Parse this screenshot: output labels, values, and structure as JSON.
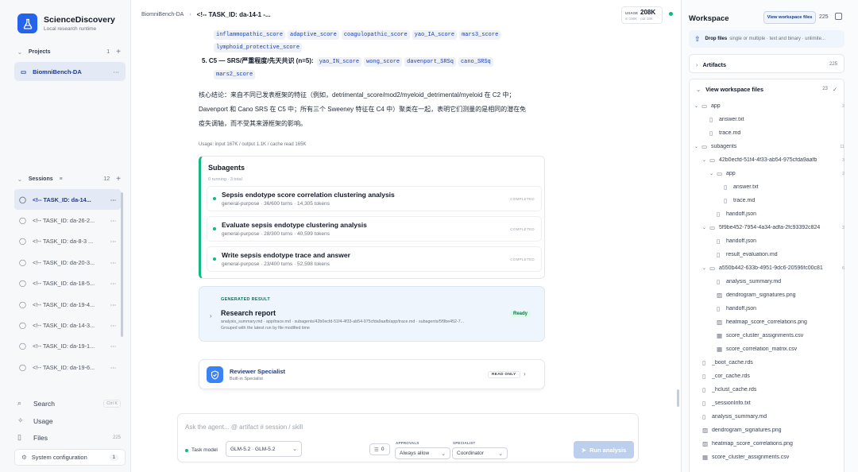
{
  "brand": {
    "name": "ScienceDiscovery",
    "subtitle": "Local research runtime"
  },
  "projects": {
    "label": "Projects",
    "count": "1",
    "items": [
      {
        "name": "BiomniBench-DA"
      }
    ]
  },
  "sessions": {
    "label": "Sessions",
    "count": "12",
    "items": [
      {
        "label": "<!-- TASK_ID: da-14..."
      },
      {
        "label": "<!-- TASK_ID: da-26-2..."
      },
      {
        "label": "<!-- TASK_ID: da-8-3 ..."
      },
      {
        "label": "<!-- TASK_ID: da-20-3..."
      },
      {
        "label": "<!-- TASK_ID: da-18-5..."
      },
      {
        "label": "<!-- TASK_ID: da-19-4..."
      },
      {
        "label": "<!-- TASK_ID: da-14-3..."
      },
      {
        "label": "<!-- TASK_ID: da-19-1..."
      },
      {
        "label": "<!-- TASK_ID: da-19-6..."
      }
    ]
  },
  "left_footer": {
    "search": "Search",
    "search_shortcut": "Ctrl K",
    "usage": "Usage",
    "files": "Files",
    "files_count": "225",
    "system_config": "System configuration",
    "system_config_badge": "1"
  },
  "header": {
    "breadcrumb_project": "BiomniBench-DA",
    "breadcrumb_task": "<!-- TASK_ID: da-14-1 -...",
    "usage_label": "USAGE",
    "usage_value": "208K",
    "usage_sub": "in 190K · out 18K"
  },
  "main": {
    "code_row1": [
      "inflammopathic_score",
      "adaptive_score",
      "coagulopathic_score",
      "yao_IA_score",
      "mars3_score"
    ],
    "code_row2": [
      "lymphoid_protective_score"
    ],
    "item5_label": "5. C5 — SRS/严重程度/先天共识 (n=5):",
    "code_row3": [
      "yao_IN_score",
      "wong_score",
      "davenport_SRSq",
      "cano_SRSq"
    ],
    "code_row4": [
      "mars2_score"
    ],
    "conclusion": "核心结论：来自不同已发表框架的特征（例如，detrimental_score/mod2/myeloid_detrimental/myeloid 在 C2 中；Davenport 和 Cano SRS 在 C5 中；所有三个 Sweeney 特征在 C4 中）聚类在一起，表明它们测量的是相同的潜在免疫失调轴，而不受其来源框架的影响。",
    "usage_line": "Usage: input 167K / output 1.1K / cache read 165K"
  },
  "subagents": {
    "title": "Subagents",
    "status": "0 running · 3 total",
    "items": [
      {
        "title": "Sepsis endotype score correlation clustering analysis",
        "detail": "general-purpose · 36/600 turns · 14,305 tokens",
        "state": "COMPLETED"
      },
      {
        "title": "Evaluate sepsis endotype clustering analysis",
        "detail": "general-purpose · 28/300 turns · 40,599 tokens",
        "state": "COMPLETED"
      },
      {
        "title": "Write sepsis endotype trace and answer",
        "detail": "general-purpose · 23/400 turns · 52,598 tokens",
        "state": "COMPLETED"
      }
    ]
  },
  "generated": {
    "label": "GENERATED RESULT",
    "title": "Research report",
    "paths": "analysis_summary.md · app/trace.md · subagents/42b0ecfd-51f4-4f33-ab54-975cfda9aafb/app/trace.md · subagents/5f9be452-7...",
    "grouped": "Grouped with the latest run by file modified time",
    "status": "Ready"
  },
  "reviewer": {
    "title": "Reviewer Specialist",
    "subtitle": "Built-in Specialist",
    "badge": "READ ONLY"
  },
  "composer": {
    "placeholder": "Ask the agent... @ artifact # session / skill",
    "task_model_label": "Task model",
    "task_model_value": "GLM-5.2 · GLM-5.2",
    "context_count": "0",
    "approvals_label": "APPROVALS",
    "approvals_value": "Always allow",
    "specialist_label": "SPECIALIST",
    "specialist_value": "Coordinator",
    "run_label": "Run analysis"
  },
  "workspace": {
    "title": "Workspace",
    "view_files_label": "View workspace files",
    "count": "225",
    "drop_title": "Drop files",
    "drop_hint": "single or multiple · text and binary · unlimite...",
    "artifacts_label": "Artifacts",
    "artifacts_count": "225",
    "files_label": "View workspace files",
    "files_count": "23",
    "tree": [
      {
        "name": "app",
        "count": "2"
      },
      {
        "name": "answer.txt"
      },
      {
        "name": "trace.md"
      },
      {
        "name": "subagents",
        "count": "11"
      },
      {
        "name": "42b0ecfd-51f4-4f33-ab54-975cfda9aafb",
        "count": "3"
      },
      {
        "name": "app",
        "count": "2"
      },
      {
        "name": "answer.txt"
      },
      {
        "name": "trace.md"
      },
      {
        "name": "handoff.json"
      },
      {
        "name": "5f9be452-7954-4a34-adfa-2fc93392c824",
        "count": "2"
      },
      {
        "name": "handoff.json"
      },
      {
        "name": "result_evaluation.md"
      },
      {
        "name": "a550b442-633b-4951-9dc6-20596fc00c81",
        "count": "6"
      },
      {
        "name": "analysis_summary.md"
      },
      {
        "name": "dendrogram_signatures.png"
      },
      {
        "name": "handoff.json"
      },
      {
        "name": "heatmap_score_correlations.png"
      },
      {
        "name": "score_cluster_assignments.csv"
      },
      {
        "name": "score_correlation_matrix.csv"
      },
      {
        "name": "_boot_cache.rds"
      },
      {
        "name": "_cor_cache.rds"
      },
      {
        "name": "_hclust_cache.rds"
      },
      {
        "name": "_sessionInfo.txt"
      },
      {
        "name": "analysis_summary.md"
      },
      {
        "name": "dendrogram_signatures.png"
      },
      {
        "name": "heatmap_score_correlations.png"
      },
      {
        "name": "score_cluster_assignments.csv"
      }
    ]
  }
}
